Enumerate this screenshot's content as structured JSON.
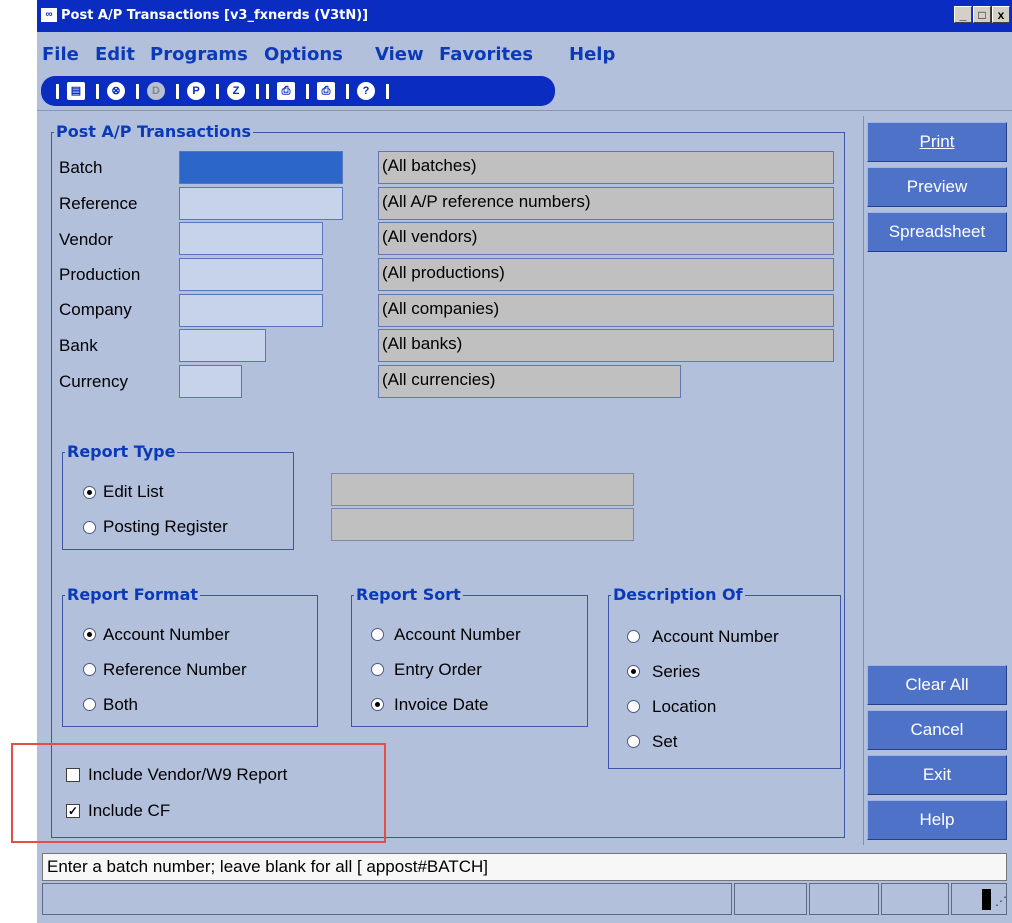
{
  "window": {
    "title": "Post A/P Transactions [v3_fxnerds (V3tN)]",
    "controls": [
      "_",
      "□",
      "x"
    ]
  },
  "menu": [
    "File",
    "Edit",
    "Programs",
    "Options",
    "View",
    "Favorites",
    "Help"
  ],
  "toolbar_icons": [
    "new-document-icon",
    "cancel-icon",
    "disabled-d-icon",
    "p-icon",
    "z-icon",
    "print-icon",
    "print-setup-icon",
    "help-icon"
  ],
  "criteria": {
    "legend": "Post  A/P Transactions",
    "rows": [
      {
        "label": "Batch",
        "desc": "(All batches)"
      },
      {
        "label": "Reference",
        "desc": "(All A/P reference numbers)"
      },
      {
        "label": "Vendor",
        "desc": "(All vendors)"
      },
      {
        "label": "Production",
        "desc": "(All productions)"
      },
      {
        "label": "Company",
        "desc": "(All companies)"
      },
      {
        "label": "Bank",
        "desc": "(All banks)"
      },
      {
        "label": "Currency",
        "desc": "(All currencies)"
      }
    ]
  },
  "report_type": {
    "legend": "Report Type",
    "options": [
      "Edit List",
      "Posting Register"
    ],
    "selected": "Edit List"
  },
  "report_format": {
    "legend": "Report Format",
    "options": [
      "Account Number",
      "Reference Number",
      "Both"
    ],
    "selected": "Account Number"
  },
  "report_sort": {
    "legend": "Report Sort",
    "options": [
      "Account Number",
      "Entry Order",
      "Invoice Date"
    ],
    "selected": "Invoice Date"
  },
  "description_of": {
    "legend": "Description Of",
    "options": [
      "Account Number",
      "Series",
      "Location",
      "Set"
    ],
    "selected": "Series"
  },
  "checkboxes": {
    "vendor_w9": {
      "label": "Include Vendor/W9 Report",
      "checked": false
    },
    "cf": {
      "label": "Include CF",
      "checked": true
    }
  },
  "buttons_top": [
    "Print",
    "Preview",
    "Spreadsheet"
  ],
  "buttons_bottom": [
    "Clear All",
    "Cancel",
    "Exit",
    "Help"
  ],
  "status": {
    "message": "Enter a batch number; leave blank for all [ appost#BATCH]"
  },
  "colors": {
    "title_bar": "#0a2cc0",
    "background": "#b3c0dc",
    "button": "#4e72c7",
    "highlight": "#e05046"
  }
}
